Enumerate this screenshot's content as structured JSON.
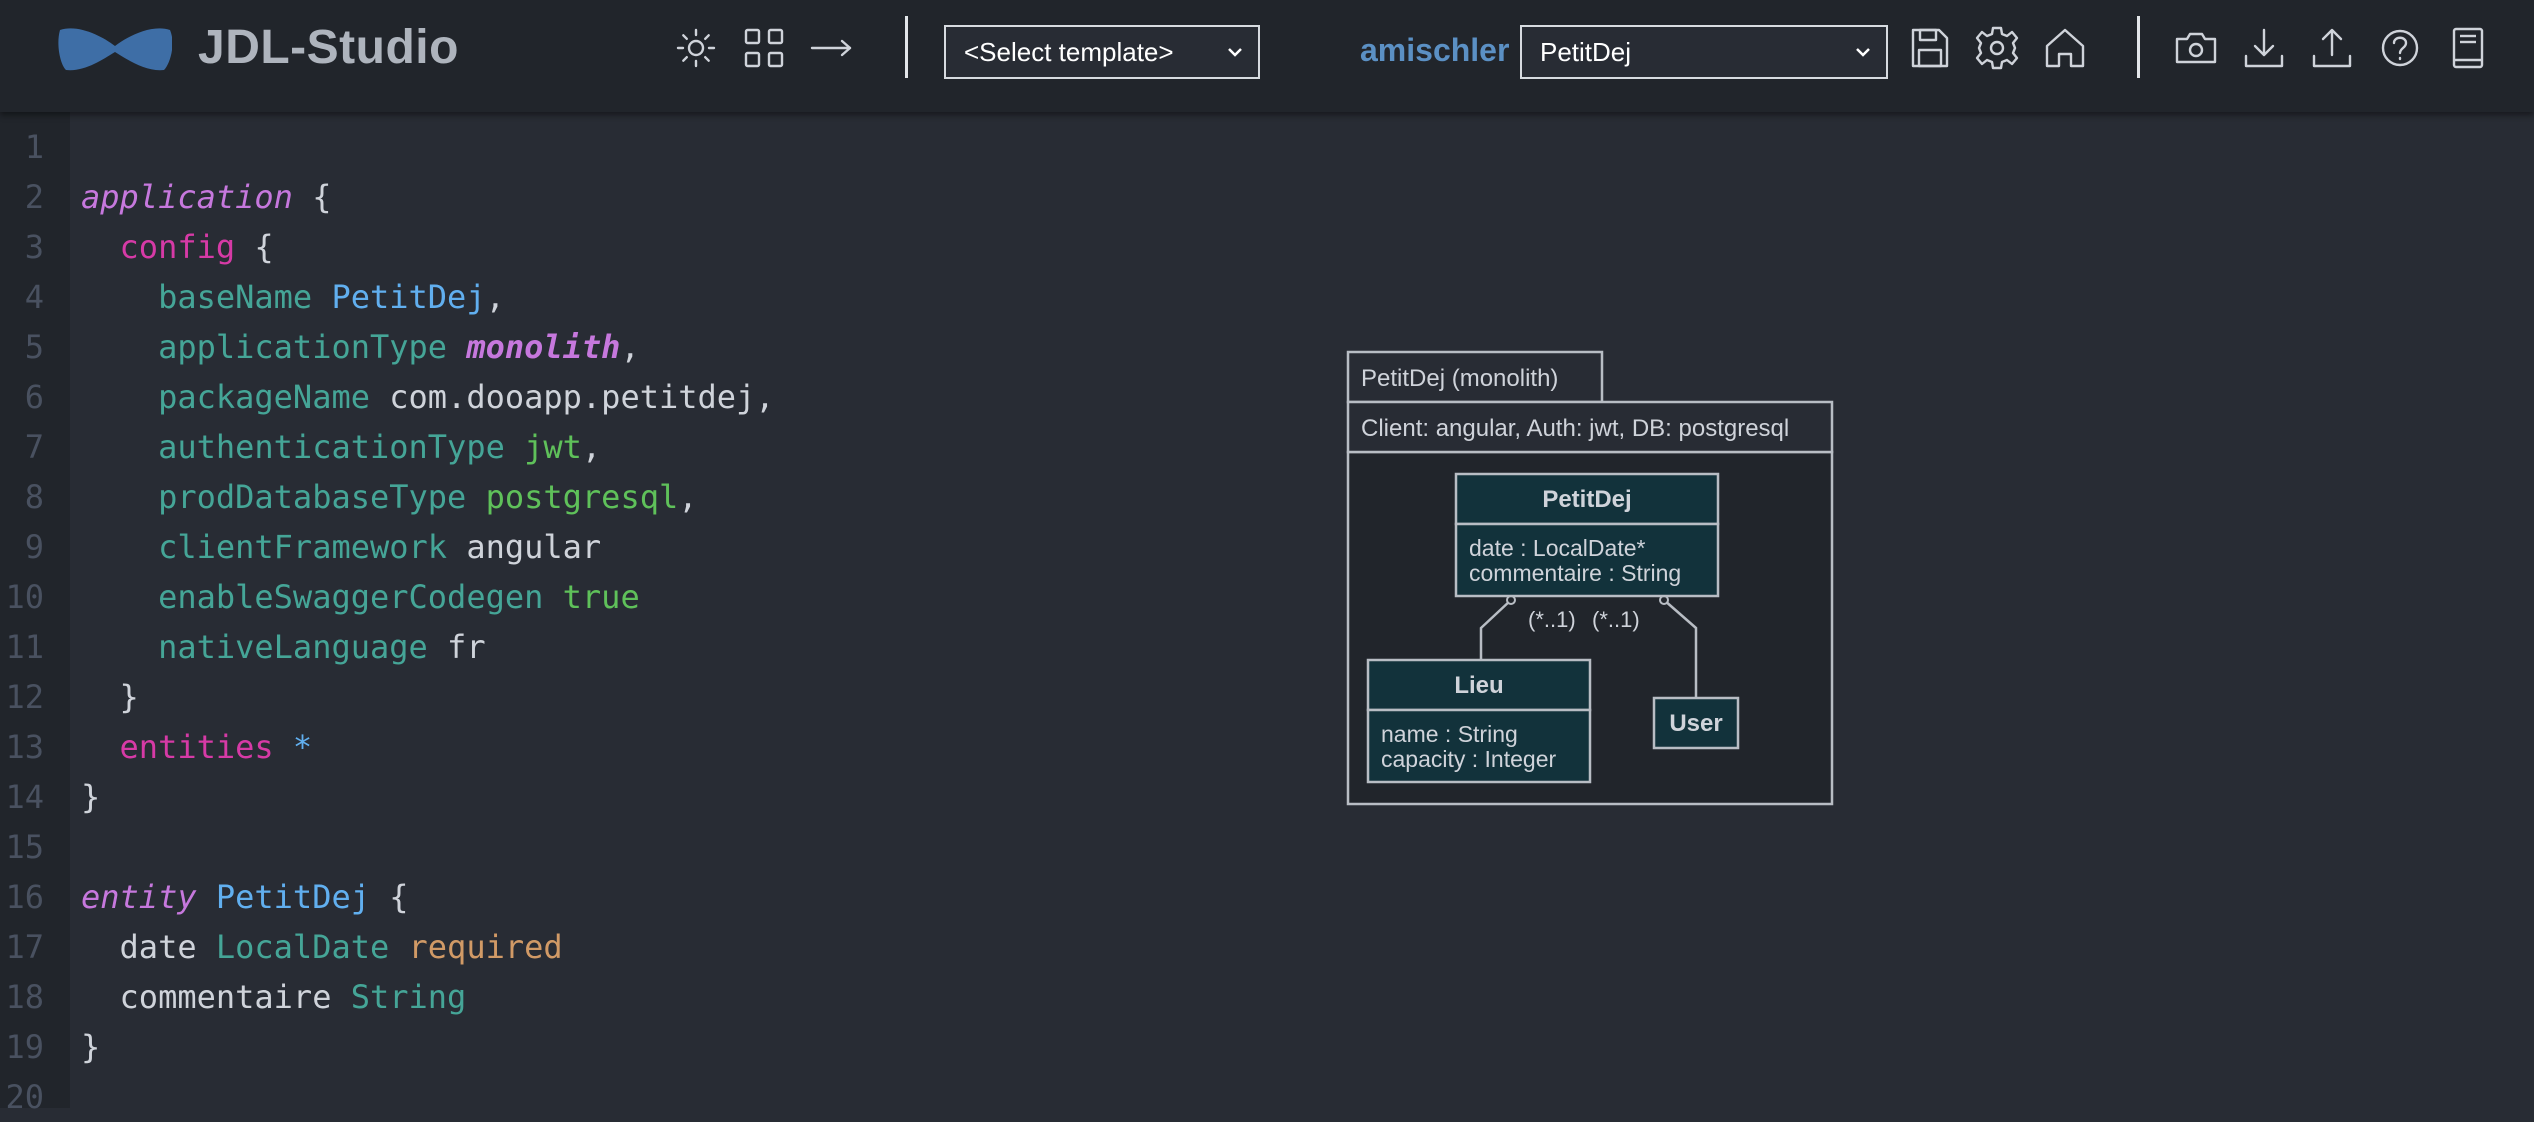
{
  "header": {
    "title": "JDL-Studio",
    "icons": {
      "theme": "sun-icon",
      "layout": "grid-icon",
      "direction": "arrow-right-icon",
      "save": "save-icon",
      "settings": "gear-icon",
      "home": "home-icon",
      "screenshot": "camera-icon",
      "download": "download-icon",
      "upload": "upload-icon",
      "help": "help-icon",
      "docs": "book-icon"
    },
    "template_select": {
      "selected": "<Select template>"
    },
    "username": "amischler",
    "project_select": {
      "selected": "PetitDej"
    }
  },
  "editor": {
    "line_numbers": [
      "1",
      "2",
      "3",
      "4",
      "5",
      "6",
      "7",
      "8",
      "9",
      "10",
      "11",
      "12",
      "13",
      "14",
      "15",
      "16",
      "17",
      "18",
      "19",
      "20"
    ],
    "lines": [
      {
        "tokens": []
      },
      {
        "tokens": [
          {
            "t": "application",
            "c": "kw-app"
          },
          {
            "t": " {",
            "c": "punct"
          }
        ]
      },
      {
        "tokens": [
          {
            "t": "  config",
            "c": "kw-pink"
          },
          {
            "t": " {",
            "c": "punct"
          }
        ]
      },
      {
        "tokens": [
          {
            "t": "    baseName",
            "c": "prop"
          },
          {
            "t": " ",
            "c": "punct"
          },
          {
            "t": "PetitDej",
            "c": "val-blue"
          },
          {
            "t": ",",
            "c": "punct"
          }
        ]
      },
      {
        "tokens": [
          {
            "t": "    applicationType",
            "c": "prop"
          },
          {
            "t": " ",
            "c": "punct"
          },
          {
            "t": "monolith",
            "c": "val-italic"
          },
          {
            "t": ",",
            "c": "punct"
          }
        ]
      },
      {
        "tokens": [
          {
            "t": "    packageName",
            "c": "prop"
          },
          {
            "t": " ",
            "c": "punct"
          },
          {
            "t": "com.dooapp.petitdej",
            "c": "val-plain"
          },
          {
            "t": ",",
            "c": "punct"
          }
        ]
      },
      {
        "tokens": [
          {
            "t": "    authenticationType",
            "c": "prop"
          },
          {
            "t": " ",
            "c": "punct"
          },
          {
            "t": "jwt",
            "c": "val-green"
          },
          {
            "t": ",",
            "c": "punct"
          }
        ]
      },
      {
        "tokens": [
          {
            "t": "    prodDatabaseType",
            "c": "prop"
          },
          {
            "t": " ",
            "c": "punct"
          },
          {
            "t": "postgresql",
            "c": "val-green"
          },
          {
            "t": ",",
            "c": "punct"
          }
        ]
      },
      {
        "tokens": [
          {
            "t": "    clientFramework",
            "c": "prop"
          },
          {
            "t": " ",
            "c": "punct"
          },
          {
            "t": "angular",
            "c": "val-plain"
          }
        ]
      },
      {
        "tokens": [
          {
            "t": "    enableSwaggerCodegen",
            "c": "prop"
          },
          {
            "t": " ",
            "c": "punct"
          },
          {
            "t": "true",
            "c": "val-green"
          }
        ]
      },
      {
        "tokens": [
          {
            "t": "    nativeLanguage",
            "c": "prop"
          },
          {
            "t": " ",
            "c": "punct"
          },
          {
            "t": "fr",
            "c": "val-plain"
          }
        ]
      },
      {
        "tokens": [
          {
            "t": "  }",
            "c": "punct"
          }
        ]
      },
      {
        "tokens": [
          {
            "t": "  entities",
            "c": "kw-pink"
          },
          {
            "t": " ",
            "c": "punct"
          },
          {
            "t": "*",
            "c": "star"
          }
        ]
      },
      {
        "tokens": [
          {
            "t": "}",
            "c": "punct"
          }
        ]
      },
      {
        "tokens": []
      },
      {
        "tokens": [
          {
            "t": "entity",
            "c": "kw-app"
          },
          {
            "t": " ",
            "c": "punct"
          },
          {
            "t": "PetitDej",
            "c": "val-blue"
          },
          {
            "t": " {",
            "c": "punct"
          }
        ]
      },
      {
        "tokens": [
          {
            "t": "  date",
            "c": "val-plain"
          },
          {
            "t": " ",
            "c": "punct"
          },
          {
            "t": "LocalDate",
            "c": "type-teal"
          },
          {
            "t": " ",
            "c": "punct"
          },
          {
            "t": "required",
            "c": "val-orange"
          }
        ]
      },
      {
        "tokens": [
          {
            "t": "  commentaire",
            "c": "val-plain"
          },
          {
            "t": " ",
            "c": "punct"
          },
          {
            "t": "String",
            "c": "type-teal"
          }
        ]
      },
      {
        "tokens": [
          {
            "t": "}",
            "c": "punct"
          }
        ]
      },
      {
        "tokens": []
      }
    ]
  },
  "diagram": {
    "app_tab": "PetitDej (monolith)",
    "app_config": "Client: angular, Auth: jwt, DB: postgresql",
    "entities": {
      "petitdej": {
        "name": "PetitDej",
        "fields": [
          "date : LocalDate*",
          "commentaire : String"
        ]
      },
      "lieu": {
        "name": "Lieu",
        "fields": [
          "name : String",
          "capacity : Integer"
        ]
      },
      "user": {
        "name": "User"
      }
    },
    "relations": {
      "lieu_label": "(*..1)",
      "user_label": "(*..1)"
    },
    "colors": {
      "entity_header": "#12323b",
      "entity_body": "#12323b",
      "border": "#b8bdc4",
      "canvas": "#21252b"
    }
  }
}
